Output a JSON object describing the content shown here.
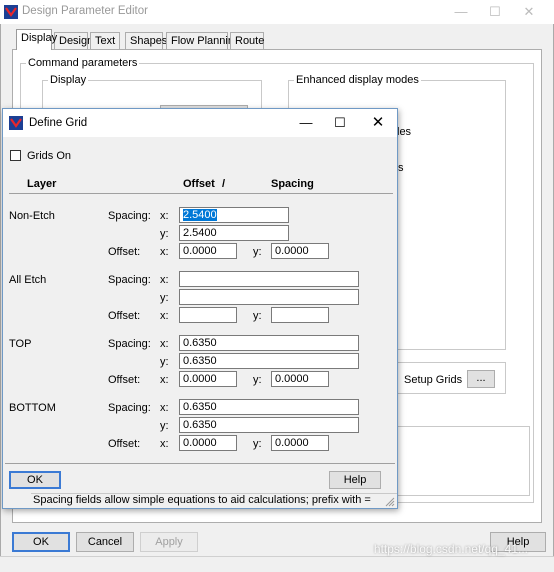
{
  "main_window": {
    "title": "Design Parameter Editor",
    "tabs": [
      "Display",
      "Design",
      "Text",
      "Shapes",
      "Flow Planning",
      "Route"
    ],
    "active_tab": "Display",
    "command_parameters_label": "Command parameters",
    "display_group_label": "Display",
    "enhanced_group_label": "Enhanced display modes",
    "enhanced_partial_texts": [
      "les",
      "s"
    ],
    "setup_grids_label": "Setup Grids",
    "setup_grids_button": "...",
    "buttons": {
      "ok": "OK",
      "cancel": "Cancel",
      "apply": "Apply",
      "help": "Help"
    }
  },
  "define_grid": {
    "title": "Define Grid",
    "grids_on_label": "Grids On",
    "grids_on_checked": false,
    "headers": {
      "layer": "Layer",
      "offset": "Offset",
      "slash": "/",
      "spacing": "Spacing"
    },
    "labels": {
      "spacing": "Spacing:",
      "offset": "Offset:",
      "x": "x:",
      "y": "y:"
    },
    "layers": [
      {
        "name": "Non-Etch",
        "spacing_x": "2.5400",
        "spacing_y": "2.5400",
        "offset_x": "0.0000",
        "offset_y": "0.0000"
      },
      {
        "name": "All Etch",
        "spacing_x": "",
        "spacing_y": "",
        "offset_x": "",
        "offset_y": ""
      },
      {
        "name": "TOP",
        "spacing_x": "0.6350",
        "spacing_y": "0.6350",
        "offset_x": "0.0000",
        "offset_y": "0.0000"
      },
      {
        "name": "BOTTOM",
        "spacing_x": "0.6350",
        "spacing_y": "0.6350",
        "offset_x": "0.0000",
        "offset_y": "0.0000"
      }
    ],
    "buttons": {
      "ok": "OK",
      "help": "Help"
    },
    "status_text": "Spacing fields allow simple equations to aid calculations; prefix with ="
  },
  "watermark": "https://blog.csdn.net/qq_41...",
  "colors": {
    "selection": "#0078d7",
    "dialog_border": "#6f99c5",
    "default_button_border": "#3b7ad4"
  }
}
